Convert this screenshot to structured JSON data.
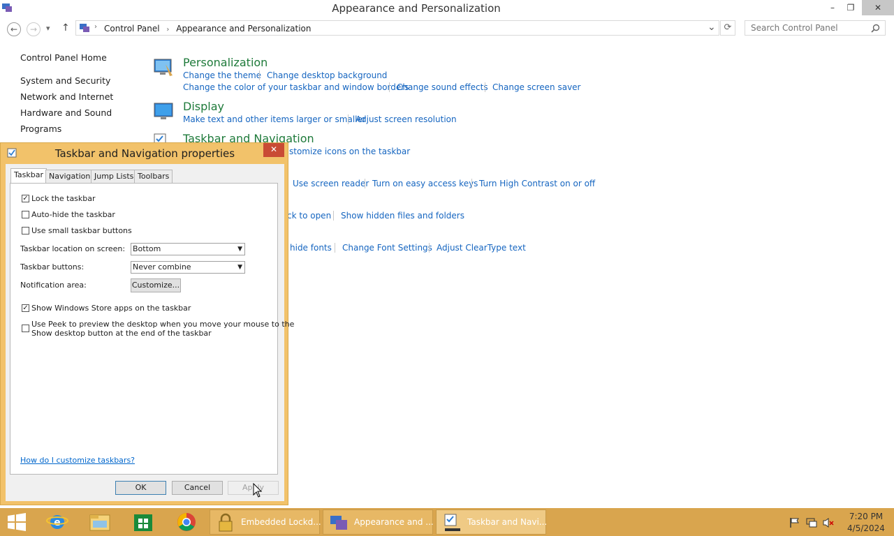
{
  "window": {
    "title": "Appearance and Personalization",
    "minimize": "–",
    "restore": "❐",
    "close": "✕"
  },
  "nav": {
    "back": "←",
    "forward": "→",
    "recent": "▾",
    "up": "↑",
    "breadcrumb": [
      "Control Panel",
      "Appearance and Personalization"
    ],
    "dropdown": "⌄",
    "refresh": "⟳",
    "search_placeholder": "Search Control Panel"
  },
  "sidebar": {
    "items": [
      {
        "label": "Control Panel Home"
      },
      {
        "label": "System and Security"
      },
      {
        "label": "Network and Internet"
      },
      {
        "label": "Hardware and Sound"
      },
      {
        "label": "Programs"
      }
    ]
  },
  "categories": {
    "personalization": {
      "title": "Personalization",
      "links": [
        "Change the theme",
        "Change desktop background",
        "Change the color of your taskbar and window borders",
        "Change sound effects",
        "Change screen saver"
      ]
    },
    "display": {
      "title": "Display",
      "links": [
        "Make text and other items larger or smaller",
        "Adjust screen resolution"
      ]
    },
    "taskbar": {
      "title": "Taskbar and Navigation",
      "links": [
        "stomize icons on the taskbar"
      ]
    },
    "ease": {
      "links": [
        "Use screen reader",
        "Turn on easy access keys",
        "Turn High Contrast on or off"
      ]
    },
    "folder": {
      "links": [
        "ck to open",
        "Show hidden files and folders"
      ]
    },
    "fonts": {
      "links": [
        "hide fonts",
        "Change Font Settings",
        "Adjust ClearType text"
      ]
    }
  },
  "dialog": {
    "title": "Taskbar and Navigation properties",
    "close": "✕",
    "tabs": [
      "Taskbar",
      "Navigation",
      "Jump Lists",
      "Toolbars"
    ],
    "checkboxes": {
      "lock": {
        "label": "Lock the taskbar",
        "checked": true
      },
      "autohide": {
        "label": "Auto-hide the taskbar",
        "checked": false
      },
      "small": {
        "label": "Use small taskbar buttons",
        "checked": false
      },
      "store": {
        "label": "Show Windows Store apps on the taskbar",
        "checked": true
      },
      "peek": {
        "label_line1": "Use Peek to preview the desktop when you move your mouse to the",
        "label_line2": "Show desktop button at the end of the taskbar",
        "checked": false
      }
    },
    "location_label": "Taskbar location on screen:",
    "location_value": "Bottom",
    "buttons_label": "Taskbar buttons:",
    "buttons_value": "Never combine",
    "notification_label": "Notification area:",
    "customize_button": "Customize...",
    "help_link": "How do I customize taskbars?",
    "ok": "OK",
    "cancel": "Cancel",
    "apply": "Apply"
  },
  "taskbar": {
    "tasks": [
      {
        "label": "Embedded Lockd..."
      },
      {
        "label": "Appearance and ..."
      },
      {
        "label": "Taskbar and Navi..."
      }
    ],
    "time": "7:20 PM",
    "date": "4/5/2024"
  },
  "colors": {
    "accent": "#f2c26a",
    "taskbar": "#d9a54e",
    "link": "#1565c0",
    "category_title": "#1e7a3a",
    "close": "#c94b35"
  }
}
